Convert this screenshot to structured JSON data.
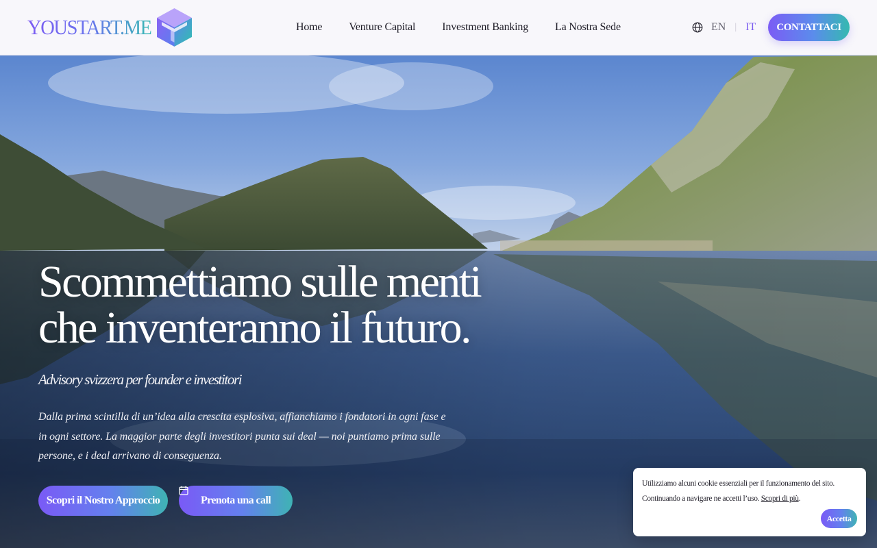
{
  "header": {
    "brand": "YOUSTART.ME",
    "nav": [
      "Home",
      "Venture Capital",
      "Investment Banking",
      "La Nostra Sede"
    ],
    "lang_en": "EN",
    "lang_sep": "|",
    "lang_it": "IT",
    "cta": "CONTATTACI"
  },
  "hero": {
    "headline_line1": "Scommettiamo sulle menti",
    "headline_line2": "che inventeranno il futuro.",
    "subtitle": "Advisory svizzera per founder e investitori",
    "lead": "Dalla prima scintilla di un’idea alla crescita esplosiva, affianchiamo i fondatori in ogni fase e in ogni settore. La maggior parte degli investitori punta sui deal — noi puntiamo prima sulle persone, e i deal arrivano di conseguenza.",
    "btn_primary": "Scopri il Nostro Approccio",
    "btn_secondary": "Prenota una call"
  },
  "cookie": {
    "text": "Utilizziamo alcuni cookie essenziali per il funzionamento del sito. Continuando a navigare ne accetti l’uso.",
    "link": "Scopri di più",
    "end": ".",
    "accept": "Accetta"
  },
  "colors": {
    "accent_purple": "#7a5af6",
    "accent_teal": "#36b8b4",
    "header_bg": "#f8f7fb"
  },
  "icons": [
    "logo-cube-icon",
    "globe-icon",
    "calendar-icon"
  ]
}
